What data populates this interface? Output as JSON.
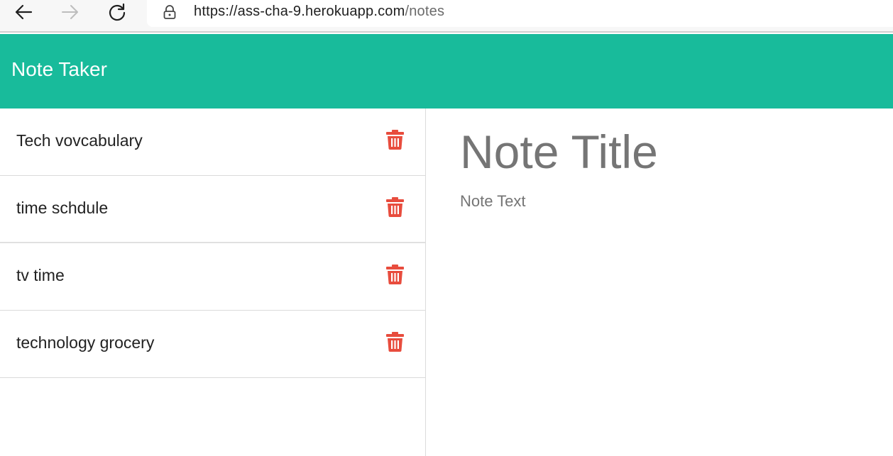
{
  "browser": {
    "url_main": "https://ass-cha-9.herokuapp.com",
    "url_path": "/notes",
    "icons": {
      "back": "arrow-left-icon",
      "forward": "arrow-right-icon",
      "reload": "reload-icon",
      "lock": "lock-icon"
    }
  },
  "header": {
    "title": "Note Taker",
    "background": "#18bb9b"
  },
  "notes": [
    {
      "title": "Tech vovcabulary",
      "delete_icon": "trash-icon"
    },
    {
      "title": "time schdule",
      "delete_icon": "trash-icon"
    },
    {
      "title": "tv time",
      "delete_icon": "trash-icon"
    },
    {
      "title": "technology grocery",
      "delete_icon": "trash-icon"
    }
  ],
  "editor": {
    "title_placeholder": "Note Title",
    "text_placeholder": "Note Text"
  },
  "colors": {
    "accent": "#18bb9b",
    "delete": "#e84c3d",
    "placeholder": "#757575"
  }
}
